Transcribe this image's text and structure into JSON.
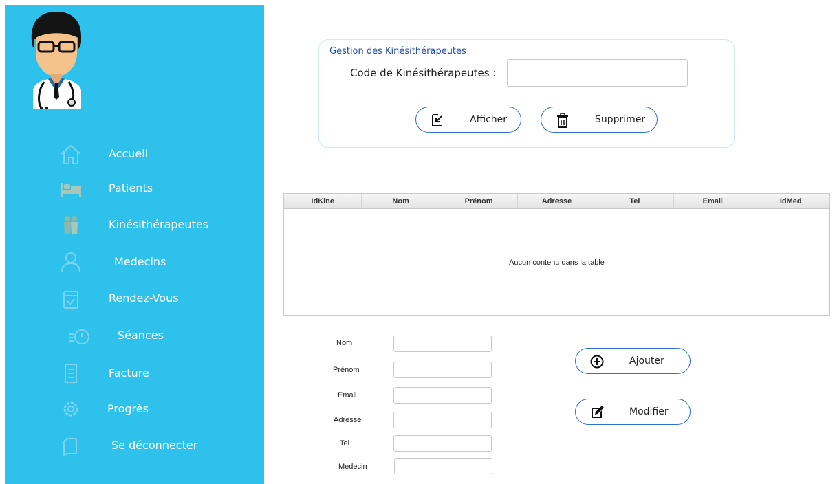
{
  "sidebar": {
    "items": [
      {
        "label": "Accueil",
        "icon": "home-icon"
      },
      {
        "label": "Patients",
        "icon": "bed-icon"
      },
      {
        "label": "Kinésithérapeutes",
        "icon": "people-icon"
      },
      {
        "label": "Medecins",
        "icon": "doctor-icon"
      },
      {
        "label": "Rendez-Vous",
        "icon": "calendar-icon"
      },
      {
        "label": "Séances",
        "icon": "stopwatch-icon"
      },
      {
        "label": "Facture",
        "icon": "invoice-icon"
      },
      {
        "label": "Progrès",
        "icon": "gear-icon"
      },
      {
        "label": "Se déconnecter",
        "icon": "logout-icon"
      }
    ]
  },
  "panel": {
    "title": "Gestion des Kinésithérapeutes",
    "code_label": "Code de Kinésithérapeutes :",
    "code_value": "",
    "show_button": "Afficher",
    "delete_button": "Supprimer"
  },
  "table": {
    "columns": [
      "IdKine",
      "Nom",
      "Prénom",
      "Adresse",
      "Tel",
      "Email",
      "IdMed"
    ],
    "empty_message": "Aucun contenu dans la table"
  },
  "form": {
    "fields": [
      {
        "label": "Nom",
        "value": ""
      },
      {
        "label": "Prénom",
        "value": ""
      },
      {
        "label": "Email",
        "value": ""
      },
      {
        "label": "Adresse",
        "value": ""
      },
      {
        "label": "Tel",
        "value": ""
      },
      {
        "label": "Medecin",
        "value": ""
      }
    ],
    "add_button": "Ajouter",
    "edit_button": "Modifier"
  },
  "colors": {
    "sidebar_bg": "#2ec1ec",
    "accent": "#2e6fd0",
    "panel_title": "#1f4faa"
  }
}
